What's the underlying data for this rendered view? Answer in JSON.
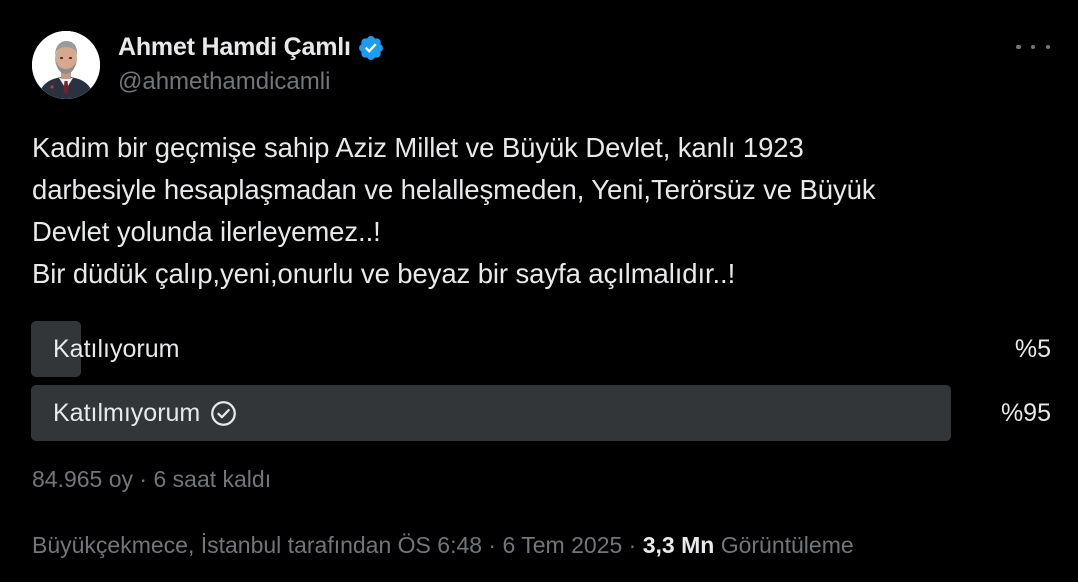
{
  "author": {
    "display_name": "Ahmet Hamdi Çamlı",
    "handle": "@ahmethamdicamli",
    "verified": true,
    "verified_color": "#1d9bf0"
  },
  "tweet": {
    "text": "Kadim bir geçmişe sahip Aziz Millet  ve Büyük Devlet, kanlı 1923\ndarbesiyle hesaplaşmadan ve helalleşmeden, Yeni,Terörsüz ve Büyük\nDevlet yolunda ilerleyemez..!\nBir düdük çalıp,yeni,onurlu ve beyaz bir sayfa açılmalıdır..!"
  },
  "poll": {
    "options": [
      {
        "label": "Katılıyorum",
        "percent_label": "%5",
        "percent": 5,
        "voted": false
      },
      {
        "label": "Katılmıyorum",
        "percent_label": "%95",
        "percent": 95,
        "voted": true
      }
    ],
    "meta": "84.965 oy · 6 saat kaldı"
  },
  "footer": {
    "location_time": "Büyükçekmece, İstanbul tarafından ÖS 6:48",
    "separator": " · ",
    "date": "6 Tem 2025",
    "views_count": "3,3 Mn",
    "views_label": "Görüntüleme"
  },
  "icons": {
    "verified": "verified-badge-icon",
    "more": "more-options-icon",
    "voted": "check-circle-icon"
  },
  "colors": {
    "background": "#000000",
    "text": "#e7e9ea",
    "secondary_text": "#71767b",
    "poll_bar": "#333639",
    "accent": "#1d9bf0"
  }
}
